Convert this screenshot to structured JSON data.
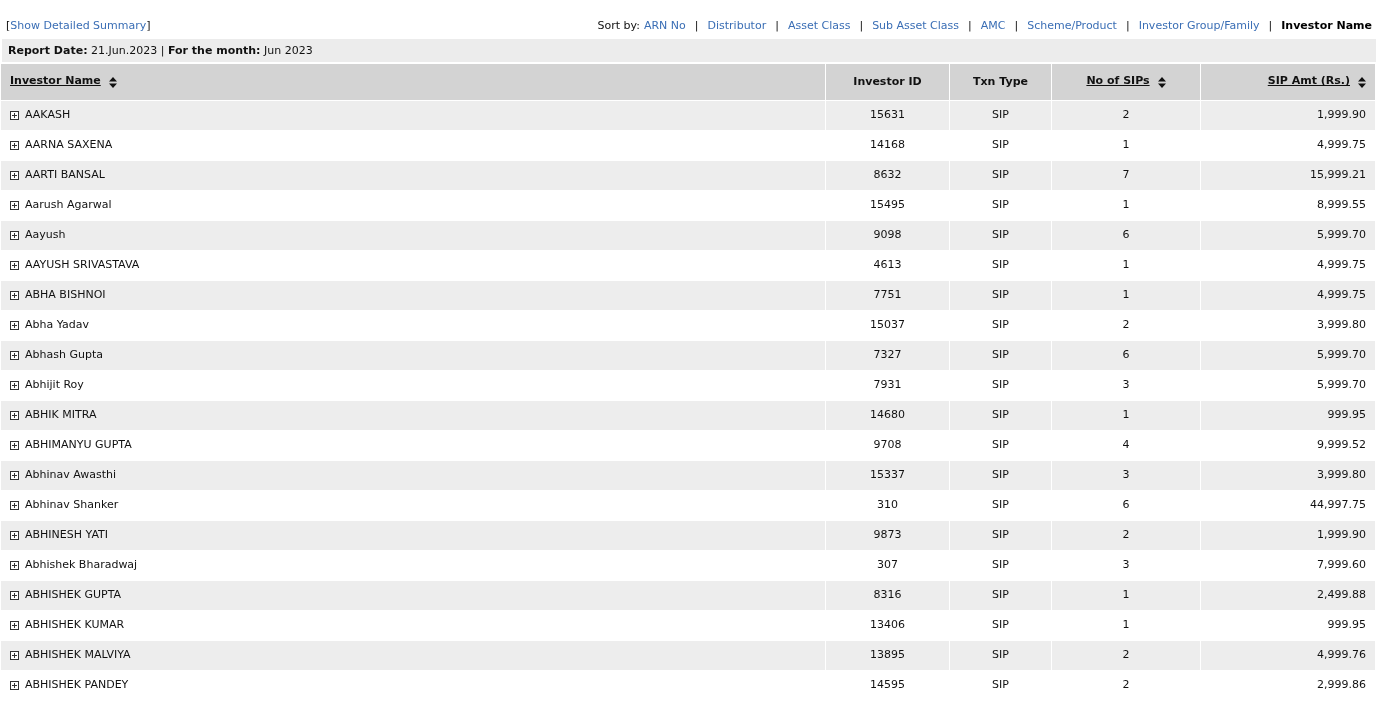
{
  "summary_link": {
    "open": "[",
    "label": "Show Detailed Summary",
    "close": "]"
  },
  "sort": {
    "label": "Sort by:",
    "separator": "|",
    "options": [
      {
        "label": "ARN No",
        "selected": false
      },
      {
        "label": "Distributor",
        "selected": false
      },
      {
        "label": "Asset Class",
        "selected": false
      },
      {
        "label": "Sub Asset Class",
        "selected": false
      },
      {
        "label": "AMC",
        "selected": false
      },
      {
        "label": "Scheme/Product",
        "selected": false
      },
      {
        "label": "Investor Group/Family",
        "selected": false
      },
      {
        "label": "Investor Name",
        "selected": true
      }
    ]
  },
  "report_line": "**Report Date:** 21.Jun.2023 | **For the month:** Jun 2023",
  "table": {
    "columns": [
      {
        "label": "Investor Name",
        "sortable": true
      },
      {
        "label": "Investor ID",
        "sortable": false
      },
      {
        "label": "Txn Type",
        "sortable": false
      },
      {
        "label": "No of SIPs",
        "sortable": true
      },
      {
        "label": "SIP Amt (Rs.)",
        "sortable": true
      }
    ],
    "rows": [
      [
        "AAKASH",
        "15631",
        "SIP",
        "2",
        "1,999.90"
      ],
      [
        "AARNA SAXENA",
        "14168",
        "SIP",
        "1",
        "4,999.75"
      ],
      [
        "AARTI BANSAL",
        "8632",
        "SIP",
        "7",
        "15,999.21"
      ],
      [
        "Aarush Agarwal",
        "15495",
        "SIP",
        "1",
        "8,999.55"
      ],
      [
        "Aayush",
        "9098",
        "SIP",
        "6",
        "5,999.70"
      ],
      [
        "AAYUSH SRIVASTAVA",
        "4613",
        "SIP",
        "1",
        "4,999.75"
      ],
      [
        "ABHA BISHNOI",
        "7751",
        "SIP",
        "1",
        "4,999.75"
      ],
      [
        "Abha Yadav",
        "15037",
        "SIP",
        "2",
        "3,999.80"
      ],
      [
        "Abhash Gupta",
        "7327",
        "SIP",
        "6",
        "5,999.70"
      ],
      [
        "Abhijit Roy",
        "7931",
        "SIP",
        "3",
        "5,999.70"
      ],
      [
        "ABHIK MITRA",
        "14680",
        "SIP",
        "1",
        "999.95"
      ],
      [
        "ABHIMANYU GUPTA",
        "9708",
        "SIP",
        "4",
        "9,999.52"
      ],
      [
        "Abhinav Awasthi",
        "15337",
        "SIP",
        "3",
        "3,999.80"
      ],
      [
        "Abhinav Shanker",
        "310",
        "SIP",
        "6",
        "44,997.75"
      ],
      [
        "ABHINESH YATI",
        "9873",
        "SIP",
        "2",
        "1,999.90"
      ],
      [
        "Abhishek Bharadwaj",
        "307",
        "SIP",
        "3",
        "7,999.60"
      ],
      [
        "ABHISHEK GUPTA",
        "8316",
        "SIP",
        "1",
        "2,499.88"
      ],
      [
        "ABHISHEK KUMAR",
        "13406",
        "SIP",
        "1",
        "999.95"
      ],
      [
        "ABHISHEK MALVIYA",
        "13895",
        "SIP",
        "2",
        "4,999.76"
      ],
      [
        "ABHISHEK PANDEY",
        "14595",
        "SIP",
        "2",
        "2,999.86"
      ]
    ]
  }
}
